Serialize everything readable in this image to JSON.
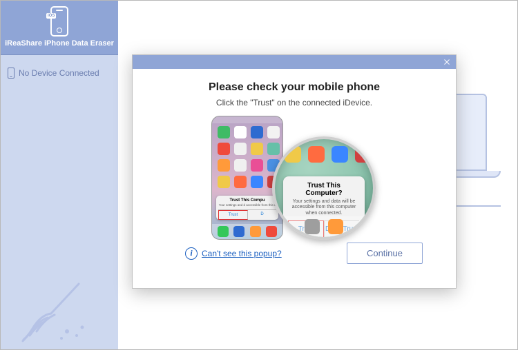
{
  "brand": {
    "name": "iReaShare iPhone Data Eraser",
    "ios_badge": "iOS"
  },
  "sidebar": {
    "device_status": "No Device Connected"
  },
  "modal": {
    "title": "Please check your mobile phone",
    "subtitle": "Click the \"Trust\" on the connected iDevice.",
    "help_link": "Can't see this popup?",
    "continue": "Continue",
    "trust_dialog": {
      "title": "Trust This Computer?",
      "body": "Your settings and data will be accessible from this computer when connected.",
      "trust": "Trust",
      "dont_trust": "Don't Trust"
    },
    "mini_dialog": {
      "title_short": "Trust This Compu",
      "body_short": "Your settings and d\naccessible from this c"
    }
  }
}
